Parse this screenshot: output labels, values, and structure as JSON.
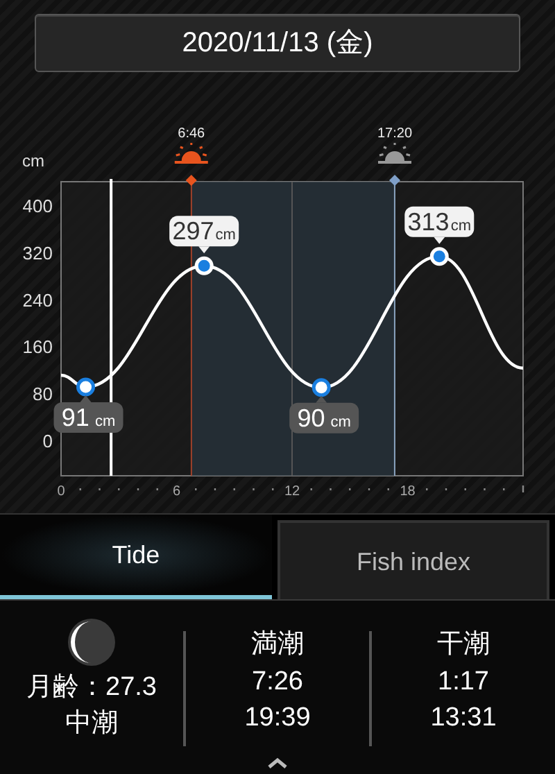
{
  "date_button": {
    "label": "2020/11/13 (金)"
  },
  "chart": {
    "sunrise_time": "6:46",
    "sunset_time": "17:20",
    "tide_labels": [
      {
        "value": "91",
        "unit": "cm"
      },
      {
        "value": "297",
        "unit": "cm"
      },
      {
        "value": "90",
        "unit": "cm"
      },
      {
        "value": "313",
        "unit": "cm"
      }
    ],
    "chart_data": {
      "type": "line",
      "ylabel": "cm",
      "x": [
        0,
        1.28,
        7.43,
        13.52,
        19.65,
        24
      ],
      "series": [
        {
          "color": "#ffffff",
          "marker": "circle",
          "values": [
            111,
            91,
            297,
            90,
            313,
            123
          ]
        }
      ],
      "xlim": [
        0,
        24
      ],
      "ylim": [
        -60,
        440
      ],
      "xticks": [
        0,
        6,
        12,
        18
      ],
      "yticks": [
        0,
        80,
        160,
        240,
        320,
        400
      ],
      "ref_lines": [
        {
          "axis": "x",
          "value": 2.6,
          "color": "#ffffff"
        },
        {
          "axis": "x",
          "value": 6.77,
          "color": "#a0412a"
        },
        {
          "axis": "x",
          "value": 17.33,
          "color": "#8aa4c0"
        }
      ],
      "bands": [
        {
          "axis": "x",
          "from": 6.77,
          "to": 17.33,
          "color": "#2a3640"
        }
      ]
    }
  },
  "tabs": [
    {
      "label": "Tide",
      "selected": true
    },
    {
      "label": "Fish index",
      "selected": false
    }
  ],
  "moon": {
    "age_label": "月齢：27.3",
    "tide_name": "中潮"
  },
  "tide_columns": [
    {
      "heading": "満潮",
      "times": [
        "7:26",
        "19:39"
      ]
    },
    {
      "heading": "干潮",
      "times": [
        "1:17",
        "13:31"
      ]
    }
  ]
}
